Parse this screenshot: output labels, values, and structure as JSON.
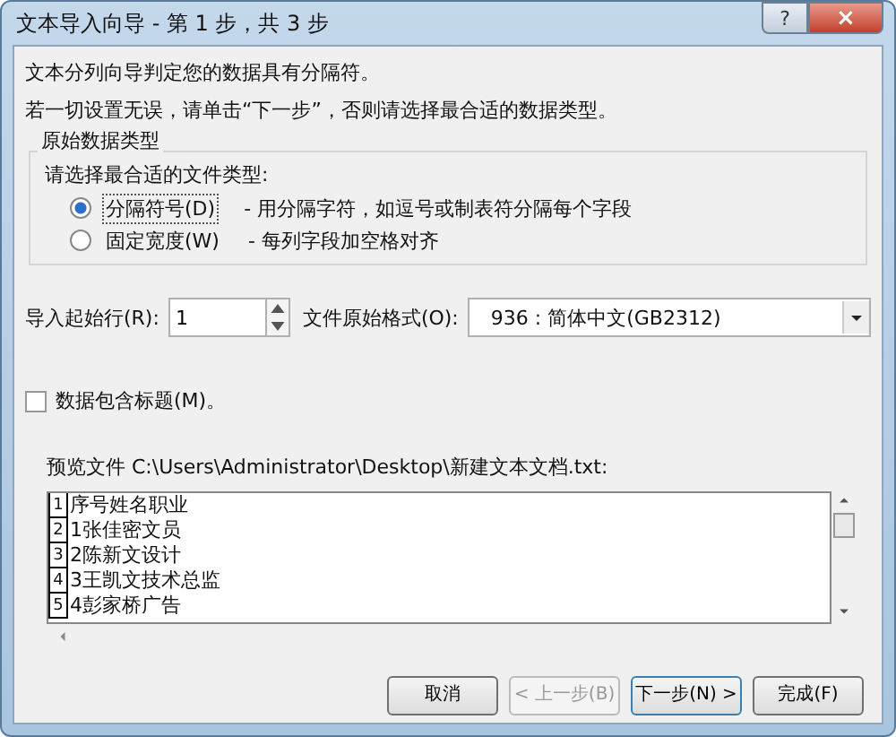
{
  "window": {
    "title": "文本导入向导 - 第 1 步，共 3 步",
    "help": "?",
    "close": "×"
  },
  "intro": [
    "文本分列向导判定您的数据具有分隔符。",
    "若一切设置无误，请单击“下一步”，否则请选择最合适的数据类型。"
  ],
  "data_type_group": {
    "title": "原始数据类型",
    "prompt": "请选择最合适的文件类型:",
    "options": [
      {
        "label": "分隔符号(D)",
        "description": "- 用分隔字符，如逗号或制表符分隔每个字段",
        "selected": true
      },
      {
        "label": "固定宽度(W)",
        "description": "- 每列字段加空格对齐",
        "selected": false
      }
    ]
  },
  "start_row": {
    "label": "导入起始行(R):",
    "value": "1"
  },
  "file_origin": {
    "label": "文件原始格式(O):",
    "value": "936 : 简体中文(GB2312)"
  },
  "headers_checkbox": {
    "label": "数据包含标题(M)。",
    "checked": false
  },
  "preview": {
    "label": "预览文件 C:\\Users\\Administrator\\Desktop\\新建文本文档.txt:",
    "rows": [
      {
        "number": "1",
        "text": "序号姓名职业"
      },
      {
        "number": "2",
        "text": "1张佳密文员"
      },
      {
        "number": "3",
        "text": "2陈新文设计"
      },
      {
        "number": "4",
        "text": "3王凯文技术总监"
      },
      {
        "number": "5",
        "text": "4彭家桥广告"
      }
    ]
  },
  "buttons": [
    {
      "label": "取消",
      "disabled": false
    },
    {
      "label": "< 上一步(B)",
      "disabled": true
    },
    {
      "label": "下一步(N) >",
      "disabled": false
    },
    {
      "label": "完成(F)",
      "disabled": false
    }
  ]
}
